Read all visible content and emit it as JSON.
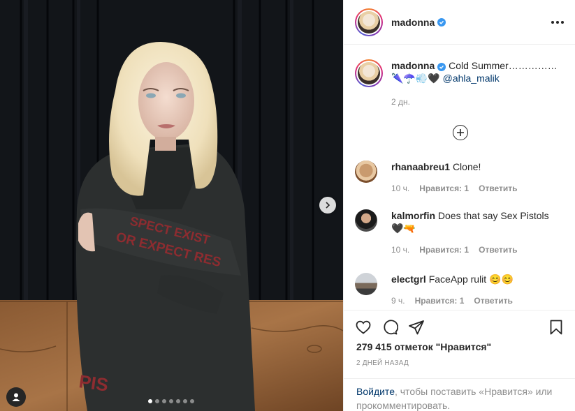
{
  "post": {
    "username": "madonna",
    "caption_text": "Cold Summer……………🌂☂️💨🖤",
    "caption_mention": "@ahla_malik",
    "caption_time": "2 дн."
  },
  "comments": [
    {
      "user": "rhanaabreu1",
      "text": "Clone!",
      "time": "10 ч.",
      "likes": "Нравится: 1",
      "reply": "Ответить"
    },
    {
      "user": "kalmorfin",
      "text": "Does that say Sex Pistols 🖤🔫",
      "time": "10 ч.",
      "likes": "Нравится: 1",
      "reply": "Ответить"
    },
    {
      "user": "electgrl",
      "text": "FaceApp rulit 😊😊",
      "time": "9 ч.",
      "likes": "Нравится: 1",
      "reply": "Ответить"
    }
  ],
  "stats": {
    "likes": "279 415 отметок \"Нравится\"",
    "date": "2 ДНЕЙ НАЗАД"
  },
  "login": {
    "link": "Войдите",
    "rest": ", чтобы поставить «Нравится» или прокомментировать."
  },
  "carousel": {
    "slides": 7,
    "active": 1
  },
  "colors": {
    "verified": "#3897f0",
    "link": "#00376b",
    "muted": "#8e8e8e"
  }
}
